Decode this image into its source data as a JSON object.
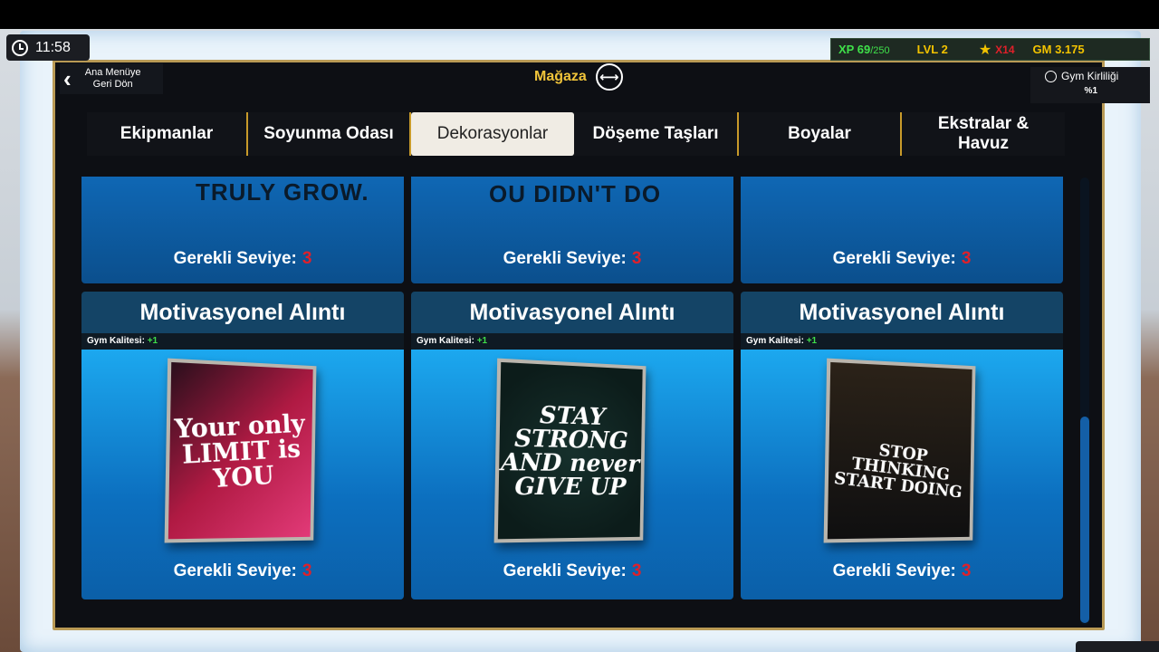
{
  "clock": {
    "time": "11:58"
  },
  "stats": {
    "xp_label": "XP 69",
    "xp_max": "/250",
    "level": "LVL 2",
    "stars": "X14",
    "gm": "GM 3.175"
  },
  "header": {
    "back_label_line1": "Ana Menüye",
    "back_label_line2": "Geri Dön",
    "title": "Mağaza",
    "dirt_label": "Gym Kirliliği",
    "dirt_value": "%1"
  },
  "tabs": [
    {
      "label": "Ekipmanlar",
      "active": false
    },
    {
      "label": "Soyunma Odası",
      "active": false
    },
    {
      "label": "Dekorasyonlar",
      "active": true
    },
    {
      "label": "Döşeme Taşları",
      "active": false
    },
    {
      "label": "Boyalar",
      "active": false
    },
    {
      "label": "Ekstralar & Havuz",
      "active": false
    }
  ],
  "top_row": [
    {
      "art": "TRULY GROW.",
      "req_label": "Gerekli Seviye:",
      "req_level": "3"
    },
    {
      "art": "OU DIDN'T DO",
      "req_label": "Gerekli Seviye:",
      "req_level": "3"
    },
    {
      "art": "",
      "req_label": "Gerekli Seviye:",
      "req_level": "3"
    }
  ],
  "cards": [
    {
      "title": "Motivasyonel Alıntı",
      "quality_label": "Gym Kalitesi:",
      "quality_value": "+1",
      "poster_text": "Your only LIMIT is YOU",
      "req_label": "Gerekli Seviye:",
      "req_level": "3"
    },
    {
      "title": "Motivasyonel Alıntı",
      "quality_label": "Gym Kalitesi:",
      "quality_value": "+1",
      "poster_text": "STAY STRONG AND never GIVE UP",
      "req_label": "Gerekli Seviye:",
      "req_level": "3"
    },
    {
      "title": "Motivasyonel Alıntı",
      "quality_label": "Gym Kalitesi:",
      "quality_value": "+1",
      "poster_text": "STOP THINKING START DOING",
      "req_label": "Gerekli Seviye:",
      "req_level": "3"
    }
  ],
  "colors": {
    "accent_gold": "#f0c43a",
    "level_red": "#e0202a",
    "xp_green": "#3fe04a",
    "card_blue": "#1ca8ef"
  }
}
